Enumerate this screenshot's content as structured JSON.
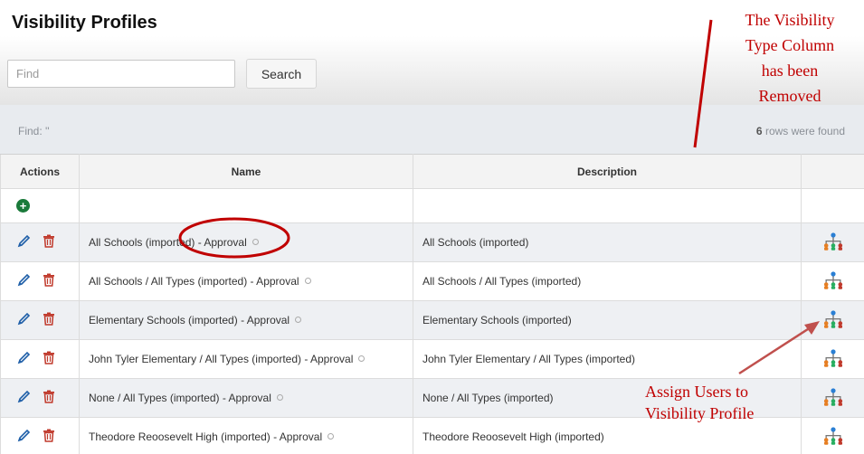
{
  "header": {
    "title": "Visibility Profiles",
    "search_placeholder": "Find",
    "search_value": "",
    "search_button": "Search"
  },
  "find_bar": {
    "find_label": "Find: ''",
    "rows_count": "6",
    "rows_suffix": " rows were found"
  },
  "table": {
    "columns": [
      "Actions",
      "Name",
      "Description",
      ""
    ],
    "rows": [
      {
        "name": "All Schools (imported) - Approval",
        "description": "All Schools (imported)"
      },
      {
        "name": "All Schools / All Types (imported) - Approval",
        "description": "All Schools / All Types (imported)"
      },
      {
        "name": "Elementary Schools (imported) - Approval",
        "description": "Elementary Schools (imported)"
      },
      {
        "name": "John Tyler Elementary / All Types (imported) - Approval",
        "description": "John Tyler Elementary / All Types (imported)"
      },
      {
        "name": "None / All Types (imported) - Approval",
        "description": "None / All Types (imported)"
      },
      {
        "name": "Theodore Reoosevelt High (imported) - Approval",
        "description": "Theodore Reoosevelt High (imported)"
      }
    ]
  },
  "annotations": {
    "top_note": [
      "The Visibility",
      "Type Column",
      "has been",
      "Removed"
    ],
    "bottom_note": [
      "Assign Users to",
      "Visibility Profile"
    ],
    "color": "#c00000"
  },
  "icons": {
    "add": "plus-circle-icon",
    "edit": "pencil-icon",
    "delete": "trash-icon",
    "assign": "org-chart-icon",
    "info": "circle-icon"
  }
}
